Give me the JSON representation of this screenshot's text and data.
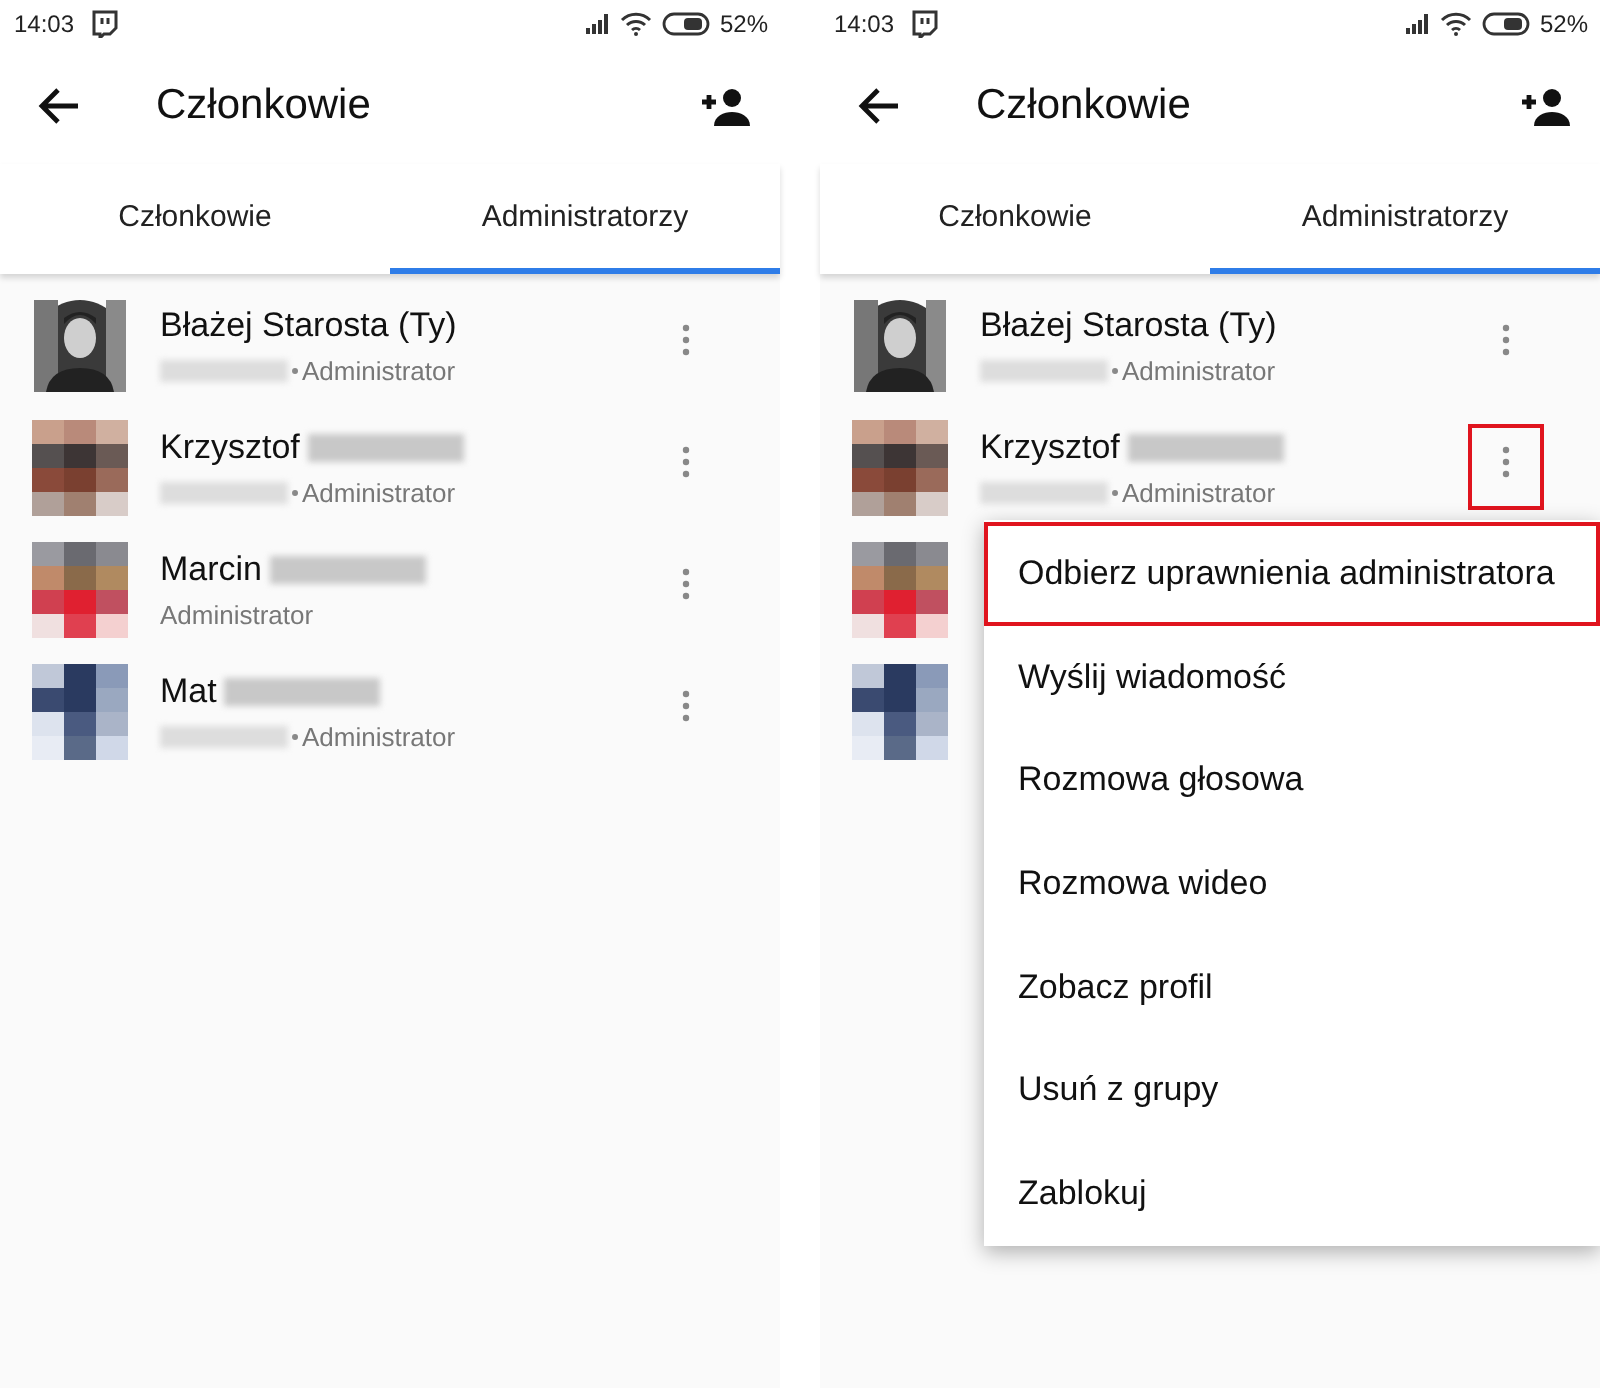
{
  "panels": [
    {
      "status_bar": {
        "time": "14:03",
        "battery": "52%"
      },
      "header": {
        "title": "Członkowie"
      },
      "tabs": [
        {
          "label": "Członkowie",
          "selected": false
        },
        {
          "label": "Administratorzy",
          "selected": true
        }
      ],
      "members": [
        {
          "name": "Błażej Starosta (Ty)",
          "name_blurred": false,
          "subtitle": "Administrator",
          "subtitle_blurred": true,
          "more_button": true,
          "highlighted": false
        },
        {
          "name": "Krzysztof",
          "name_blurred": true,
          "subtitle": "Administrator",
          "subtitle_blurred": true,
          "more_button": true,
          "highlighted": false
        },
        {
          "name": "Marcin",
          "name_blurred": true,
          "subtitle": "Administrator",
          "subtitle_blurred": false,
          "more_button": true,
          "highlighted": false
        },
        {
          "name": "Mat",
          "name_blurred": true,
          "subtitle": "Administrator",
          "subtitle_blurred": true,
          "more_button": true,
          "highlighted": false
        }
      ]
    },
    {
      "status_bar": {
        "time": "14:03",
        "battery": "52%"
      },
      "header": {
        "title": "Członkowie"
      },
      "tabs": [
        {
          "label": "Członkowie",
          "selected": false
        },
        {
          "label": "Administratorzy",
          "selected": true
        }
      ],
      "members": [
        {
          "name": "Błażej Starosta (Ty)",
          "name_blurred": false,
          "subtitle": "Administrator",
          "subtitle_blurred": true,
          "more_button": true,
          "highlighted": false
        },
        {
          "name": "Krzysztof",
          "name_blurred": true,
          "subtitle": "Administrator",
          "subtitle_blurred": true,
          "more_button": true,
          "highlighted": true
        },
        {
          "more_button": false
        },
        {
          "more_button": false
        }
      ],
      "menu": [
        {
          "label": "Odbierz uprawnienia administratora",
          "highlighted": true
        },
        {
          "label": "Wyślij wiadomość",
          "highlighted": false
        },
        {
          "label": "Rozmowa głosowa",
          "highlighted": false
        },
        {
          "label": "Rozmowa wideo",
          "highlighted": false
        },
        {
          "label": "Zobacz profil",
          "highlighted": false
        },
        {
          "label": "Usuń z grupy",
          "highlighted": false
        },
        {
          "label": "Zablokuj",
          "highlighted": false
        }
      ]
    }
  ]
}
